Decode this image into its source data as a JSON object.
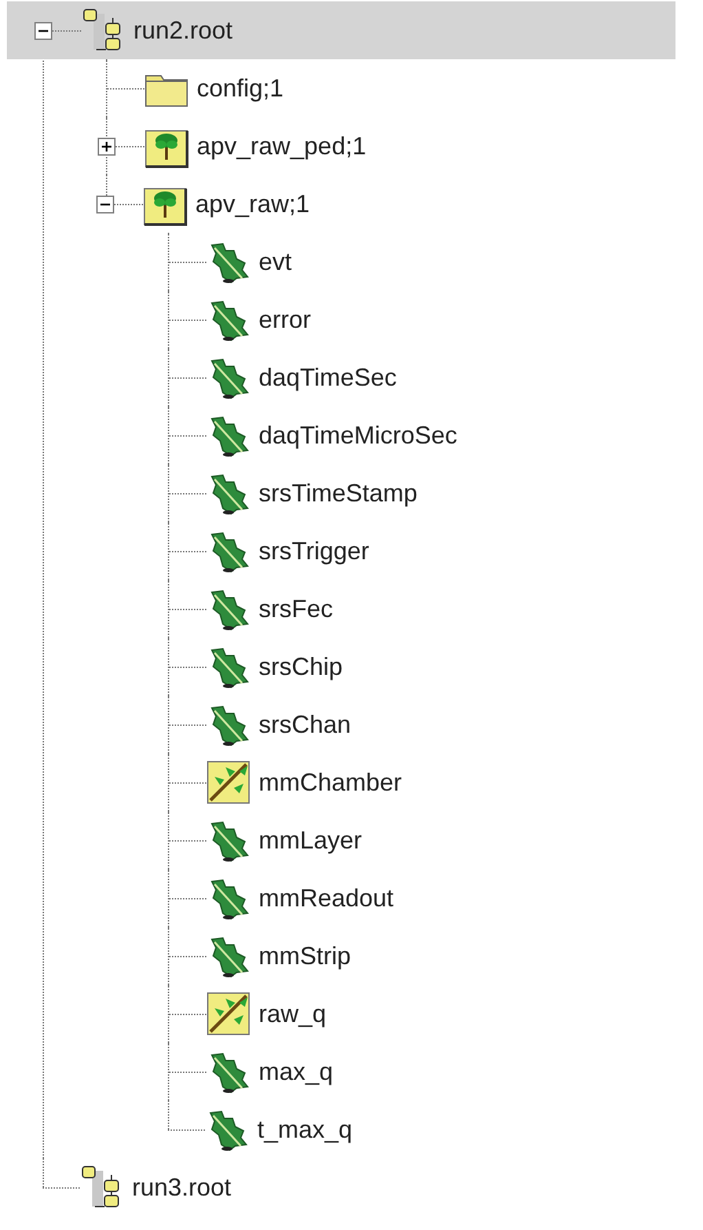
{
  "tree": [
    {
      "label": "run2.root",
      "kind": "file",
      "selected": true,
      "expanded": true,
      "children": [
        {
          "label": "config;1",
          "kind": "folder",
          "selected": false
        },
        {
          "label": "apv_raw_ped;1",
          "kind": "tree",
          "selected": false,
          "expanded": false
        },
        {
          "label": "apv_raw;1",
          "kind": "tree",
          "selected": false,
          "expanded": true,
          "children": [
            {
              "label": "evt",
              "kind": "leaf",
              "selected": false
            },
            {
              "label": "error",
              "kind": "leaf",
              "selected": false
            },
            {
              "label": "daqTimeSec",
              "kind": "leaf",
              "selected": false
            },
            {
              "label": "daqTimeMicroSec",
              "kind": "leaf",
              "selected": false
            },
            {
              "label": "srsTimeStamp",
              "kind": "leaf",
              "selected": false
            },
            {
              "label": "srsTrigger",
              "kind": "leaf",
              "selected": false
            },
            {
              "label": "srsFec",
              "kind": "leaf",
              "selected": false
            },
            {
              "label": "srsChip",
              "kind": "leaf",
              "selected": false
            },
            {
              "label": "srsChan",
              "kind": "leaf",
              "selected": false
            },
            {
              "label": "mmChamber",
              "kind": "branch",
              "selected": false
            },
            {
              "label": "mmLayer",
              "kind": "leaf",
              "selected": false
            },
            {
              "label": "mmReadout",
              "kind": "leaf",
              "selected": false
            },
            {
              "label": "mmStrip",
              "kind": "leaf",
              "selected": false
            },
            {
              "label": "raw_q",
              "kind": "branch",
              "selected": false
            },
            {
              "label": "max_q",
              "kind": "leaf",
              "selected": false
            },
            {
              "label": "t_max_q",
              "kind": "leaf",
              "selected": false
            }
          ]
        }
      ]
    },
    {
      "label": "run3.root",
      "kind": "file",
      "selected": false
    }
  ]
}
